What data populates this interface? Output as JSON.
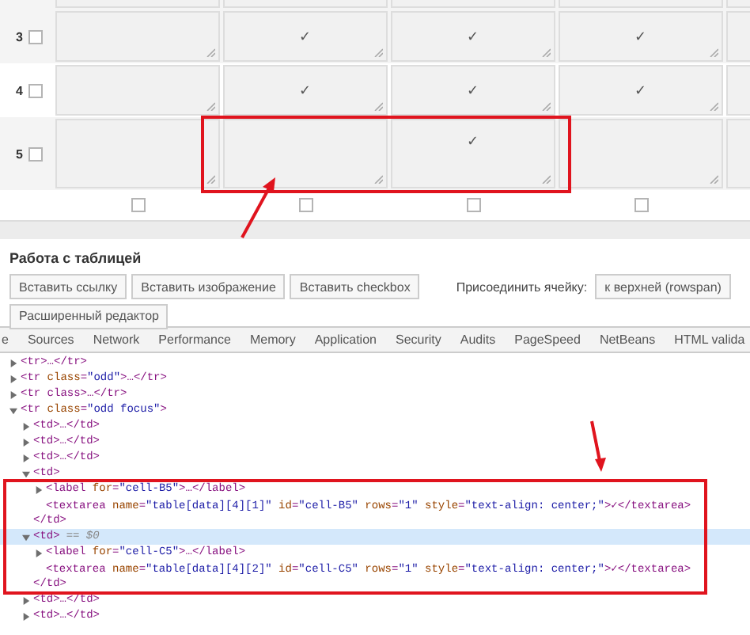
{
  "table": {
    "rows": [
      {
        "number": "3",
        "checked": false,
        "cells": [
          {
            "kind": "empty"
          },
          {
            "kind": "text",
            "text": "✓"
          },
          {
            "kind": "text",
            "text": "✓"
          },
          {
            "kind": "text",
            "text": "✓"
          },
          {
            "kind": "partial"
          }
        ]
      },
      {
        "number": "4",
        "checked": false,
        "cells": [
          {
            "kind": "empty"
          },
          {
            "kind": "text",
            "text": "✓"
          },
          {
            "kind": "text",
            "text": "✓"
          },
          {
            "kind": "text",
            "text": "✓"
          },
          {
            "kind": "partial"
          }
        ]
      },
      {
        "number": "5",
        "checked": false,
        "cells": [
          {
            "kind": "empty"
          },
          {
            "kind": "empty"
          },
          {
            "kind": "text",
            "text": "✓"
          },
          {
            "kind": "empty"
          },
          {
            "kind": "partial"
          }
        ]
      }
    ],
    "column_checkboxes": [
      {
        "checked": false
      },
      {
        "checked": false
      },
      {
        "checked": false
      },
      {
        "checked": false
      }
    ]
  },
  "panel": {
    "title": "Работа с таблицей",
    "buttons": [
      "Вставить ссылку",
      "Вставить изображение",
      "Вставить checkbox"
    ],
    "merge_label": "Присоединить ячейку:",
    "merge_buttons": [
      "к верхней (rowspan)"
    ],
    "editor_button": "Расширенный редактор"
  },
  "devtools": {
    "tabs": [
      {
        "label": "e",
        "selected": false
      },
      {
        "label": "Sources",
        "selected": false
      },
      {
        "label": "Network",
        "selected": false
      },
      {
        "label": "Performance",
        "selected": false
      },
      {
        "label": "Memory",
        "selected": false
      },
      {
        "label": "Application",
        "selected": false
      },
      {
        "label": "Security",
        "selected": false
      },
      {
        "label": "Audits",
        "selected": false
      },
      {
        "label": "PageSpeed",
        "selected": false
      },
      {
        "label": "NetBeans",
        "selected": false
      },
      {
        "label": "HTML valida",
        "selected": false
      }
    ],
    "tree": [
      {
        "kind": "element",
        "text": "<tr>…</tr>",
        "expanded": false,
        "selected": false
      },
      {
        "kind": "element",
        "text": "<tr class=\"odd\">…</tr>",
        "expanded": false,
        "selected": false
      },
      {
        "kind": "element",
        "text": "<tr class>…</tr>",
        "expanded": false,
        "selected": false
      },
      {
        "kind": "element",
        "text": "<tr class=\"odd focus\">",
        "expanded": true,
        "selected": false,
        "children": [
          {
            "kind": "element",
            "text": "<td>…</td>",
            "expanded": false,
            "selected": false
          },
          {
            "kind": "element",
            "text": "<td>…</td>",
            "expanded": false,
            "selected": false
          },
          {
            "kind": "element",
            "text": "<td>…</td>",
            "expanded": false,
            "selected": false
          },
          {
            "kind": "element",
            "text": "<td>",
            "close": "</td>",
            "expanded": true,
            "selected": false,
            "children": [
              {
                "kind": "element",
                "text": "<label for=\"cell-B5\">…</label>",
                "expanded": false,
                "selected": false
              },
              {
                "kind": "leaf",
                "text": "<textarea name=\"table[data][4][1]\" id=\"cell-B5\" rows=\"1\" style=\"text-align: center;\">✓</textarea>",
                "selected": false
              }
            ]
          },
          {
            "kind": "element",
            "text": "<td>",
            "marker": "== $0",
            "close": "</td>",
            "expanded": true,
            "selected": true,
            "children": [
              {
                "kind": "element",
                "text": "<label for=\"cell-C5\">…</label>",
                "expanded": false,
                "selected": false
              },
              {
                "kind": "leaf",
                "text": "<textarea name=\"table[data][4][2]\" id=\"cell-C5\" rows=\"1\" style=\"text-align: center;\">✓</textarea>",
                "selected": false
              }
            ]
          },
          {
            "kind": "element",
            "text": "<td>…</td>",
            "expanded": false,
            "selected": false
          },
          {
            "kind": "element",
            "text": "<td>…</td>",
            "expanded": false,
            "selected": false
          }
        ]
      }
    ]
  }
}
